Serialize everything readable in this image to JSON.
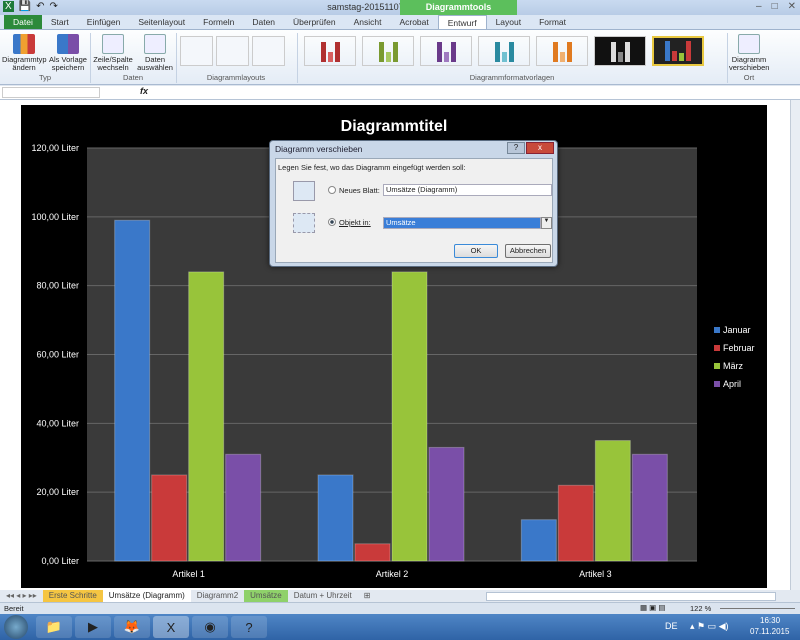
{
  "window": {
    "title": "samstag-20151107  -  Microsoft Excel",
    "context_tools": "Diagrammtools"
  },
  "tabs": [
    "Datei",
    "Start",
    "Einfügen",
    "Seitenlayout",
    "Formeln",
    "Daten",
    "Überprüfen",
    "Ansicht",
    "Acrobat",
    "Entwurf",
    "Layout",
    "Format"
  ],
  "ribbon": {
    "change_type": "Diagrammtyp ändern",
    "save_template": "Als Vorlage speichern",
    "group_type": "Typ",
    "switch_row_col": "Zeile/Spalte wechseln",
    "select_data": "Daten auswählen",
    "group_data": "Daten",
    "group_layouts": "Diagrammlayouts",
    "group_styles": "Diagrammformatvorlagen",
    "move_chart": "Diagramm verschieben",
    "group_location": "Ort"
  },
  "formula_bar": {
    "fx": "fx",
    "name_box": "",
    "formula": ""
  },
  "dialog": {
    "title": "Diagramm verschieben",
    "help": "?",
    "close": "x",
    "prompt": "Legen Sie fest, wo das Diagramm eingefügt werden soll:",
    "new_sheet_label": "Neues Blatt:",
    "new_sheet_value": "Umsätze (Diagramm)",
    "object_in_label": "Objekt in:",
    "object_in_value": "Umsätze",
    "ok": "OK",
    "cancel": "Abbrechen",
    "selected_option": "object_in"
  },
  "sheet_tabs": [
    {
      "label": "Erste Schritte",
      "color": "#f5c542"
    },
    {
      "label": "Umsätze (Diagramm)",
      "color": ""
    },
    {
      "label": "Diagramm2",
      "color": ""
    },
    {
      "label": "Umsätze",
      "color": "#8fd16a"
    },
    {
      "label": "Datum + Uhrzeit",
      "color": ""
    }
  ],
  "status": {
    "ready": "Bereit",
    "zoom": "122 %"
  },
  "taskbar": {
    "lang": "DE",
    "time": "16:30",
    "date": "07.11.2015"
  },
  "chart_data": {
    "type": "bar",
    "title": "Diagrammtitel",
    "categories": [
      "Artikel 1",
      "Artikel 2",
      "Artikel 3"
    ],
    "series": [
      {
        "name": "Januar",
        "color": "#3a78c9",
        "values": [
          99,
          25,
          12
        ]
      },
      {
        "name": "Februar",
        "color": "#c93a3a",
        "values": [
          25,
          5,
          22
        ]
      },
      {
        "name": "März",
        "color": "#98c43a",
        "values": [
          84,
          84,
          35
        ]
      },
      {
        "name": "April",
        "color": "#7a4fa8",
        "values": [
          31,
          33,
          31
        ]
      }
    ],
    "ylim": [
      0,
      120
    ],
    "yticks": [
      "0,00 Liter",
      "20,00 Liter",
      "40,00 Liter",
      "60,00 Liter",
      "80,00 Liter",
      "100,00 Liter",
      "120,00 Liter"
    ],
    "grid": true,
    "legend": "right"
  }
}
